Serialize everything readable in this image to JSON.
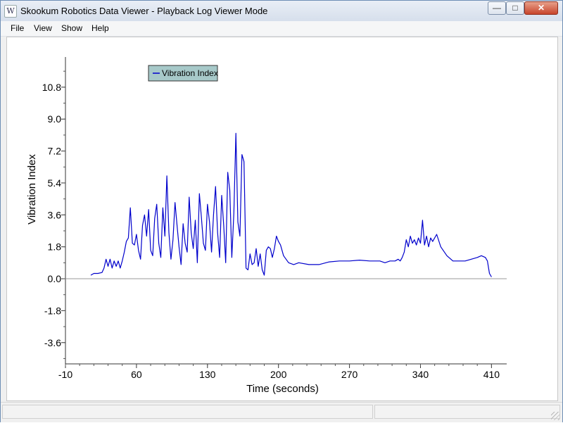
{
  "window": {
    "title": "Skookum Robotics Data Viewer - Playback Log Viewer Mode",
    "icon": "app-icon",
    "controls": {
      "minimize": "minimize-icon",
      "maximize": "maximize-icon",
      "close": "close-icon"
    }
  },
  "menu": {
    "items": [
      "File",
      "View",
      "Show",
      "Help"
    ]
  },
  "chart_data": {
    "type": "line",
    "xlabel": "Time (seconds)",
    "ylabel": "Vibration Index",
    "xlim": [
      -10,
      425
    ],
    "ylim": [
      -4.8,
      12.5
    ],
    "xticks": [
      -10,
      60,
      130,
      200,
      270,
      340,
      410
    ],
    "xtick_labels": [
      "-10",
      "60",
      "130",
      "200",
      "270",
      "340",
      "410"
    ],
    "yticks": [
      10.8,
      9.0,
      7.2,
      5.4,
      3.6,
      1.8,
      0.0,
      -1.8,
      -3.6
    ],
    "ytick_labels": [
      "10.8",
      "9.0",
      "7.2",
      "5.4",
      "3.6",
      "1.8",
      "0.0",
      "-1.8",
      "-3.6"
    ],
    "grid": false,
    "legend": "top-left",
    "series": [
      {
        "name": "Vibration Index",
        "color": "#0000cc",
        "x": [
          15,
          18,
          22,
          26,
          28,
          30,
          32,
          34,
          36,
          38,
          40,
          42,
          44,
          46,
          48,
          50,
          52,
          54,
          56,
          58,
          60,
          62,
          64,
          66,
          68,
          70,
          72,
          74,
          76,
          78,
          80,
          82,
          84,
          86,
          88,
          90,
          92,
          94,
          96,
          98,
          100,
          102,
          104,
          106,
          108,
          110,
          112,
          114,
          116,
          118,
          120,
          122,
          124,
          126,
          128,
          130,
          132,
          134,
          136,
          138,
          140,
          142,
          144,
          146,
          148,
          150,
          152,
          154,
          156,
          158,
          160,
          162,
          164,
          166,
          168,
          170,
          172,
          174,
          176,
          178,
          180,
          182,
          184,
          186,
          188,
          190,
          192,
          194,
          196,
          198,
          200,
          202,
          205,
          210,
          215,
          220,
          230,
          240,
          250,
          260,
          270,
          280,
          290,
          300,
          305,
          310,
          312,
          315,
          318,
          320,
          322,
          324,
          326,
          328,
          330,
          332,
          334,
          336,
          338,
          340,
          342,
          344,
          346,
          348,
          350,
          352,
          356,
          360,
          366,
          372,
          378,
          384,
          390,
          396,
          400,
          404,
          406,
          408,
          410
        ],
        "values": [
          0.2,
          0.3,
          0.3,
          0.35,
          0.6,
          1.1,
          0.7,
          1.1,
          0.6,
          1.0,
          0.7,
          1.0,
          0.6,
          1.0,
          1.5,
          2.1,
          2.3,
          4.0,
          2.0,
          1.9,
          2.5,
          1.6,
          1.1,
          3.0,
          3.6,
          2.4,
          3.9,
          1.6,
          1.3,
          3.4,
          4.2,
          2.0,
          1.2,
          4.0,
          2.4,
          5.8,
          2.6,
          1.1,
          2.2,
          4.3,
          3.0,
          1.8,
          0.8,
          3.1,
          2.0,
          1.5,
          4.6,
          2.6,
          1.7,
          3.3,
          0.9,
          4.8,
          3.5,
          2.0,
          1.6,
          4.2,
          3.2,
          1.5,
          3.6,
          5.2,
          2.6,
          1.2,
          4.7,
          3.0,
          0.9,
          6.0,
          5.0,
          1.2,
          3.7,
          8.2,
          3.2,
          2.4,
          7.0,
          6.6,
          0.6,
          0.5,
          1.4,
          0.8,
          0.9,
          1.7,
          0.7,
          1.4,
          0.5,
          0.2,
          1.6,
          1.8,
          1.7,
          1.2,
          1.7,
          2.4,
          2.1,
          1.9,
          1.3,
          0.9,
          0.8,
          0.9,
          0.8,
          0.8,
          0.95,
          1.0,
          1.0,
          1.05,
          1.0,
          1.0,
          0.9,
          1.0,
          1.0,
          1.0,
          1.1,
          1.0,
          1.2,
          1.5,
          2.2,
          1.8,
          2.4,
          2.0,
          2.2,
          1.9,
          2.3,
          2.0,
          3.3,
          1.9,
          2.4,
          1.8,
          2.3,
          2.1,
          2.5,
          1.8,
          1.3,
          1.0,
          1.0,
          1.0,
          1.1,
          1.2,
          1.3,
          1.2,
          1.0,
          0.3,
          0.1
        ]
      }
    ]
  }
}
